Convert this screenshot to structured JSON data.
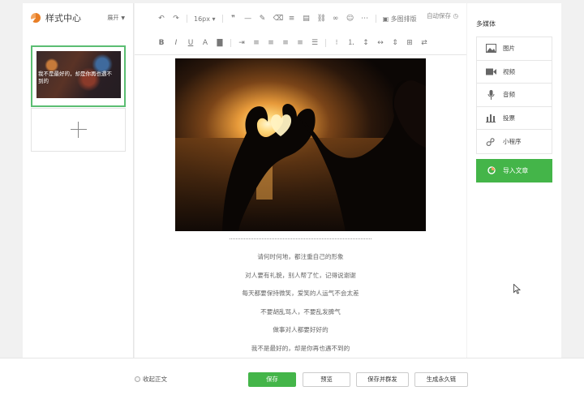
{
  "sidebar_left": {
    "title": "样式中心",
    "expand_label": "展开",
    "card_text": "我不是最好的，却是你再也遇不到的"
  },
  "toolbar": {
    "font_size": "16px",
    "multi_layout_label": "多图排版",
    "autosave_label": "自动保存"
  },
  "article": {
    "lines": [
      "请何时何地，都注重自己的形象",
      "对人要有礼貌，别人帮了忙，记得说谢谢",
      "每天都要保持微笑，爱笑的人运气不会太差",
      "不要胡乱骂人，不要乱发脾气",
      "做事对人都要好好的",
      "我不是最好的，却是你再也遇不到的"
    ]
  },
  "media_panel": {
    "title": "多媒体",
    "items": [
      {
        "label": "图片",
        "icon": "image-icon"
      },
      {
        "label": "视频",
        "icon": "video-icon"
      },
      {
        "label": "音频",
        "icon": "audio-icon"
      },
      {
        "label": "投票",
        "icon": "vote-icon"
      },
      {
        "label": "小程序",
        "icon": "mini-program-icon"
      }
    ],
    "import_label": "导入文章"
  },
  "bottom_bar": {
    "collapse_label": "收起正文",
    "save_label": "保存",
    "preview_label": "预览",
    "save_send_label": "保存并群发",
    "permanent_link_label": "生成永久链"
  },
  "colors": {
    "accent_green": "#44b549",
    "selected_border": "#5bbd72"
  }
}
